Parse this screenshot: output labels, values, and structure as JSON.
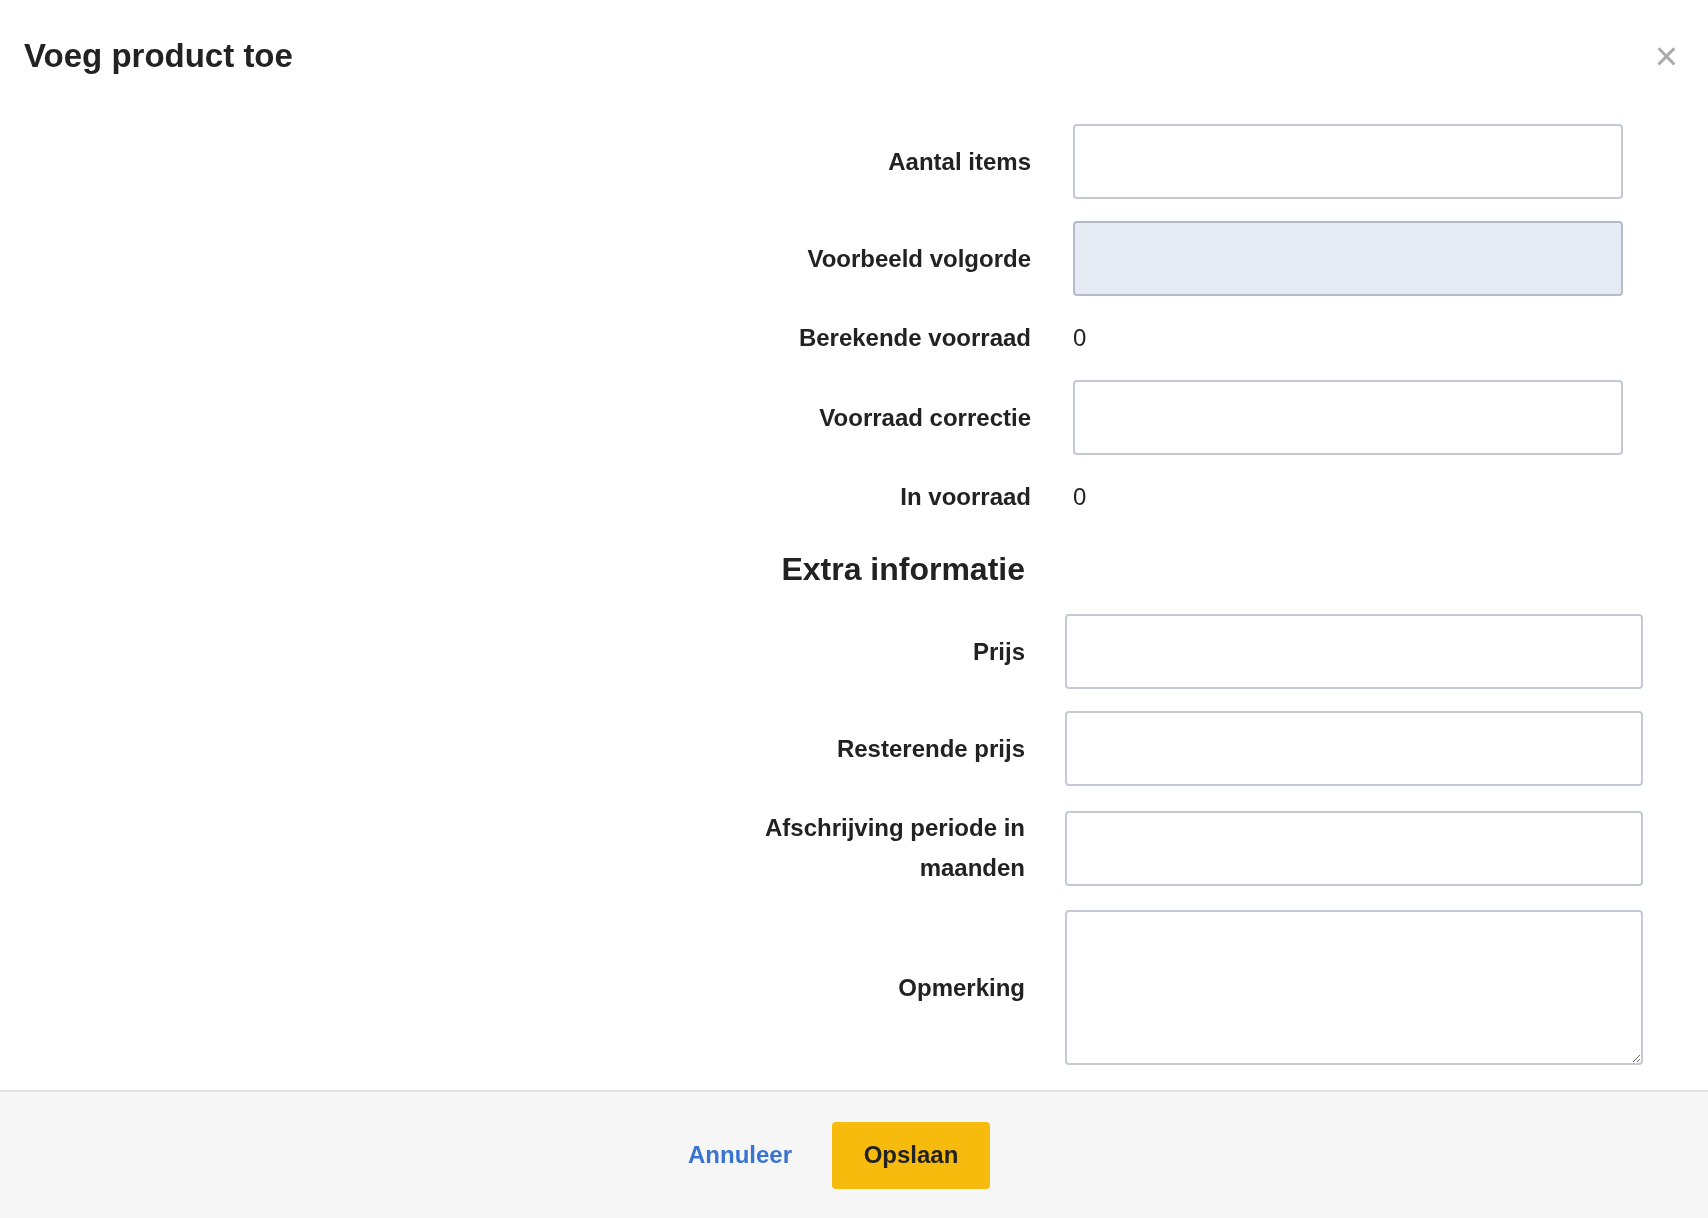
{
  "dialog": {
    "title": "Voeg product toe",
    "close": "×"
  },
  "sections": [
    {
      "fields": [
        {
          "kind": "input",
          "label": "Aantal items",
          "disabled": false
        },
        {
          "kind": "input",
          "label": "Voorbeeld volgorde",
          "disabled": true
        },
        {
          "kind": "text",
          "label": "Berekende voorraad",
          "value": "0"
        },
        {
          "kind": "input",
          "label": "Voorraad correctie",
          "disabled": false
        },
        {
          "kind": "text",
          "label": "In voorraad",
          "value": "0"
        }
      ]
    },
    {
      "heading": "Extra informatie",
      "fields": [
        {
          "kind": "input",
          "label": "Prijs",
          "disabled": false
        },
        {
          "kind": "input",
          "label": "Resterende prijs",
          "disabled": false
        },
        {
          "kind": "input",
          "label": "Afschrijving periode in maanden",
          "disabled": false
        },
        {
          "kind": "textarea",
          "label": "Opmerking",
          "disabled": false
        }
      ]
    }
  ],
  "footer": {
    "cancel": "Annuleer",
    "save": "Opslaan"
  }
}
